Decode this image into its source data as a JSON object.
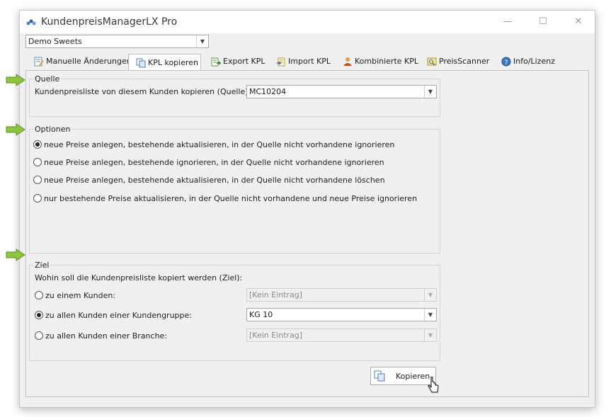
{
  "window": {
    "title": "KundenpreisManagerLX Pro",
    "min": "—",
    "max": "☐",
    "close": "✕"
  },
  "company": {
    "value": "Demo Sweets"
  },
  "tabs": [
    {
      "label": "Manuelle Änderungen"
    },
    {
      "label": "KPL kopieren"
    },
    {
      "label": "Export KPL"
    },
    {
      "label": "Import KPL"
    },
    {
      "label": "Kombinierte KPL"
    },
    {
      "label": "PreisScanner"
    },
    {
      "label": "Info/Lizenz"
    }
  ],
  "quelle": {
    "title": "Quelle",
    "label": "Kundenpreisliste von diesem Kunden kopieren (Quelle):",
    "value": "MC10204"
  },
  "optionen": {
    "title": "Optionen",
    "options": [
      {
        "label": "neue Preise anlegen, bestehende aktualisieren, in der Quelle nicht vorhandene ignorieren",
        "selected": true
      },
      {
        "label": "neue Preise anlegen, bestehende ignorieren, in der Quelle nicht vorhandene ignorieren",
        "selected": false
      },
      {
        "label": "neue Preise anlegen, bestehende aktualisieren, in der Quelle nicht vorhandene löschen",
        "selected": false
      },
      {
        "label": "nur bestehende Preise aktualisieren, in der Quelle nicht vorhandene und neue Preise ignorieren",
        "selected": false
      }
    ]
  },
  "ziel": {
    "title": "Ziel",
    "question": "Wohin soll die Kundenpreisliste kopiert werden (Ziel):",
    "options": [
      {
        "label": "zu einem Kunden:",
        "value": "[Kein Eintrag]",
        "selected": false,
        "enabled": false
      },
      {
        "label": "zu allen Kunden einer Kundengruppe:",
        "value": "KG 10",
        "selected": true,
        "enabled": true
      },
      {
        "label": "zu allen Kunden einer Branche:",
        "value": "[Kein Eintrag]",
        "selected": false,
        "enabled": false
      }
    ]
  },
  "kopieren_button": {
    "label": "Kopieren"
  },
  "colors": {
    "accent_green": "#7dbb2e",
    "border": "#d4d4d4",
    "window_bg": "#f0f0f0"
  }
}
